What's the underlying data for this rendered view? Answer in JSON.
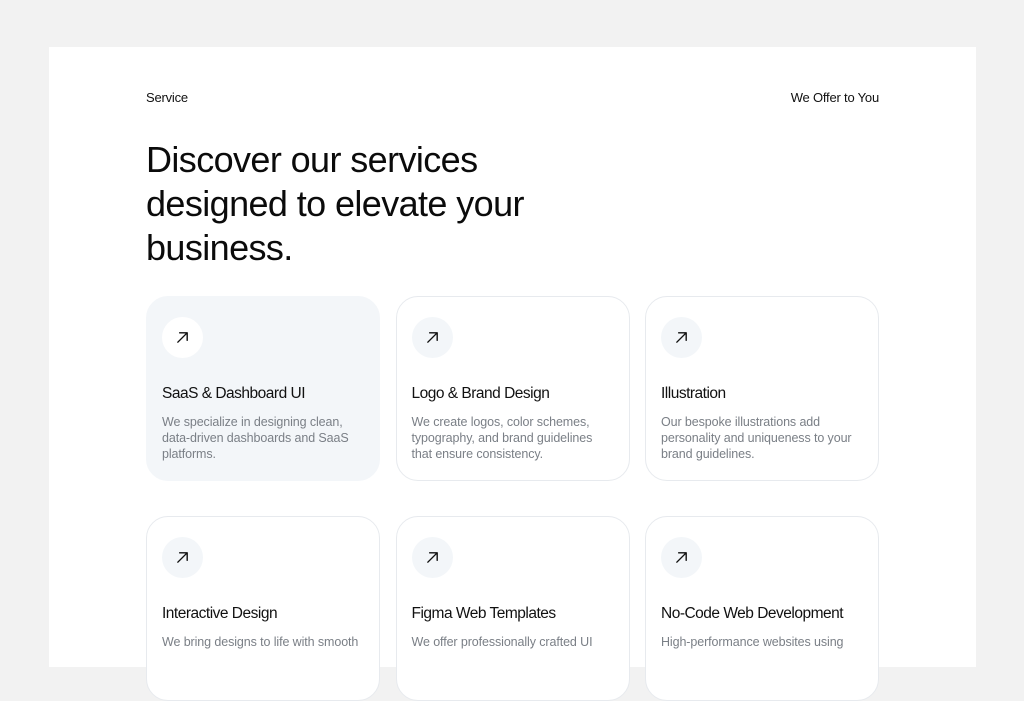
{
  "header": {
    "eyebrow_left": "Service",
    "eyebrow_right": "We Offer to You",
    "headline": "Discover our services designed to elevate your business."
  },
  "services": [
    {
      "icon": "arrow-up-right-icon",
      "title": "SaaS & Dashboard UI",
      "description": "We specialize in designing clean, data-driven dashboards and SaaS platforms."
    },
    {
      "icon": "arrow-up-right-icon",
      "title": "Logo & Brand Design",
      "description": "We create logos, color schemes, typography, and brand guidelines that ensure consistency."
    },
    {
      "icon": "arrow-up-right-icon",
      "title": "Illustration",
      "description": "Our bespoke illustrations add personality and uniqueness to your brand guidelines."
    },
    {
      "icon": "arrow-up-right-icon",
      "title": "Interactive Design",
      "description": "We bring designs to life with smooth"
    },
    {
      "icon": "arrow-up-right-icon",
      "title": "Figma Web Templates",
      "description": "We offer professionally crafted UI"
    },
    {
      "icon": "arrow-up-right-icon",
      "title": "No-Code Web Development",
      "description": "High-performance websites using"
    }
  ],
  "colors": {
    "page_background": "#f2f2f2",
    "panel_background": "#ffffff",
    "active_card": "#f3f6f9",
    "card_border": "#e7eaee",
    "muted_text": "#7a7f86"
  }
}
